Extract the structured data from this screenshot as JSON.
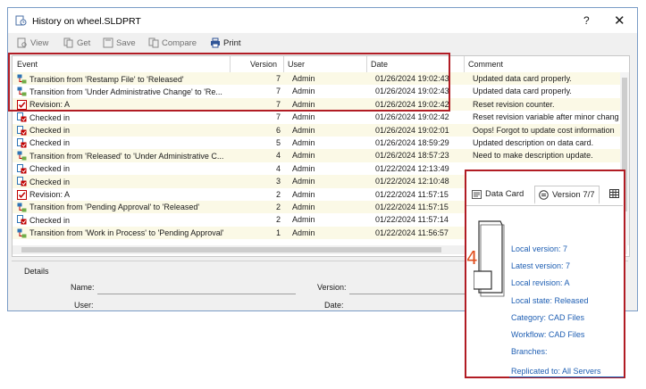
{
  "window": {
    "title": "History on wheel.SLDPRT",
    "help": "?",
    "close": "✕"
  },
  "toolbar": {
    "view": "View",
    "get": "Get",
    "save": "Save",
    "compare": "Compare",
    "print": "Print"
  },
  "table": {
    "headers": {
      "event": "Event",
      "version": "Version",
      "user": "User",
      "date": "Date",
      "comment": "Comment"
    },
    "rows": [
      {
        "icon": "transition",
        "event": "Transition from 'Restamp File' to 'Released'",
        "version": "7",
        "user": "Admin",
        "date": "01/26/2024 19:02:43",
        "comment": "Updated data card properly."
      },
      {
        "icon": "transition",
        "event": "Transition from 'Under Administrative Change' to 'Re...",
        "version": "7",
        "user": "Admin",
        "date": "01/26/2024 19:02:43",
        "comment": "Updated data card properly."
      },
      {
        "icon": "revision",
        "event": "Revision: A",
        "version": "7",
        "user": "Admin",
        "date": "01/26/2024 19:02:42",
        "comment": "Reset revision counter."
      },
      {
        "icon": "checkin",
        "event": "Checked in",
        "version": "7",
        "user": "Admin",
        "date": "01/26/2024 19:02:42",
        "comment": "Reset revision variable after minor chang"
      },
      {
        "icon": "checkin",
        "event": "Checked in",
        "version": "6",
        "user": "Admin",
        "date": "01/26/2024 19:02:01",
        "comment": "Oops! Forgot to update cost information"
      },
      {
        "icon": "checkin",
        "event": "Checked in",
        "version": "5",
        "user": "Admin",
        "date": "01/26/2024 18:59:29",
        "comment": "Updated description on data card."
      },
      {
        "icon": "transition",
        "event": "Transition from 'Released' to 'Under Administrative C...",
        "version": "4",
        "user": "Admin",
        "date": "01/26/2024 18:57:23",
        "comment": "Need to make description update."
      },
      {
        "icon": "checkin",
        "event": "Checked in",
        "version": "4",
        "user": "Admin",
        "date": "01/22/2024 12:13:49",
        "comment": ""
      },
      {
        "icon": "checkin",
        "event": "Checked in",
        "version": "3",
        "user": "Admin",
        "date": "01/22/2024 12:10:48",
        "comment": ""
      },
      {
        "icon": "revision",
        "event": "Revision: A",
        "version": "2",
        "user": "Admin",
        "date": "01/22/2024 11:57:15",
        "comment": ""
      },
      {
        "icon": "transition",
        "event": "Transition from 'Pending Approval' to 'Released'",
        "version": "2",
        "user": "Admin",
        "date": "01/22/2024 11:57:15",
        "comment": ""
      },
      {
        "icon": "checkin",
        "event": "Checked in",
        "version": "2",
        "user": "Admin",
        "date": "01/22/2024 11:57:14",
        "comment": ""
      },
      {
        "icon": "transition",
        "event": "Transition from 'Work in Process' to 'Pending Approval'",
        "version": "1",
        "user": "Admin",
        "date": "01/22/2024 11:56:57",
        "comment": ""
      }
    ]
  },
  "details": {
    "legend": "Details",
    "name": "Name:",
    "user": "User:",
    "version": "Version:",
    "date": "Date:"
  },
  "overlay": {
    "tab_datacard": "Data Card",
    "tab_version": "Version 7/7",
    "badge": "4",
    "fields": [
      "Local version: 7",
      "Latest version: 7",
      "Local revision: A",
      "Local state: Released",
      "Category: CAD Files",
      "Workflow: CAD Files",
      "Branches:",
      "Replicated to: All Servers"
    ]
  },
  "colors": {
    "highlight": "#b11c24",
    "row_alt": "#fbf9e6",
    "link": "#1f5fb3"
  }
}
